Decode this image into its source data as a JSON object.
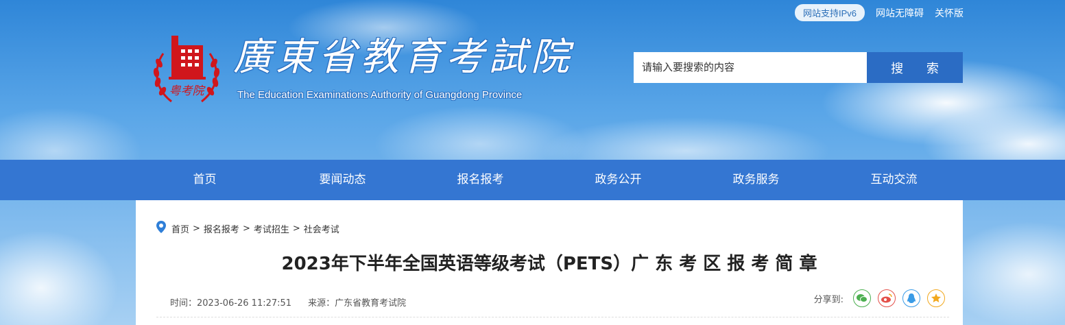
{
  "topbar": {
    "ipv6": "网站支持IPv6",
    "accessibility": "网站无障碍",
    "care_mode": "关怀版"
  },
  "header": {
    "logo_text": "粤考院",
    "site_name": "廣東省教育考試院",
    "site_name_en": "The Education Examinations Authority of Guangdong Province"
  },
  "search": {
    "placeholder": "请输入要搜索的内容",
    "button_label": "搜 索"
  },
  "nav": {
    "items": [
      {
        "label": "首页"
      },
      {
        "label": "要闻动态"
      },
      {
        "label": "报名报考"
      },
      {
        "label": "政务公开"
      },
      {
        "label": "政务服务"
      },
      {
        "label": "互动交流"
      }
    ]
  },
  "breadcrumb": {
    "items": [
      "首页",
      "报名报考",
      "考试招生",
      "社会考试"
    ],
    "separator": ">"
  },
  "article": {
    "title": "2023年下半年全国英语等级考试（PETS）广 东 考 区 报 考 简 章",
    "time": "时间：2023-06-26 11:27:51",
    "source": "来源：广东省教育考试院",
    "share_label": "分享到:",
    "share_icons": [
      "wechat-icon",
      "weibo-icon",
      "qq-icon",
      "qzone-icon"
    ]
  },
  "colors": {
    "nav": "#3476d2",
    "search_button": "#2b6cc4",
    "logo_red": "#d0161c",
    "wechat": "#4caf50",
    "weibo": "#e4504a",
    "qq": "#3a9be6",
    "qzone": "#f2a81d"
  }
}
